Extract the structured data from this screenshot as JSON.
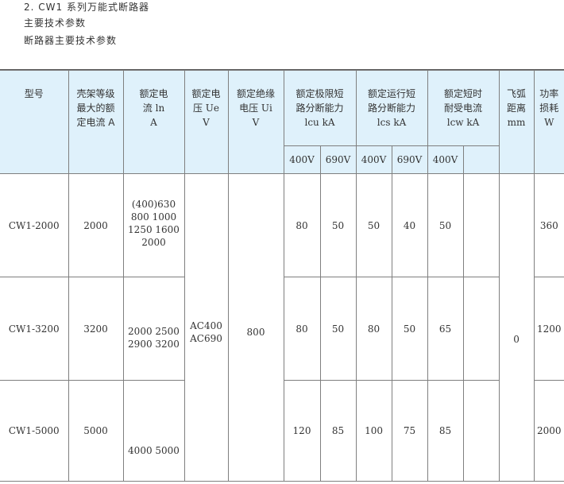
{
  "headings": {
    "line1": "2. CW1 系列万能式断路器",
    "line2": "主要技术参数",
    "line3": "断路器主要技术参数"
  },
  "table": {
    "headers": {
      "model": "型号",
      "frame_lines": [
        "壳架等级",
        "最大的额",
        "定电流 A"
      ],
      "rated_current_lines": [
        "额定电",
        "流 ln",
        "A"
      ],
      "rated_voltage_lines": [
        "额定电",
        "压 Ue",
        "V"
      ],
      "insulation_voltage_lines": [
        "额定绝缘",
        "电压 Ui",
        "V"
      ],
      "icu_lines": [
        "额定极限短",
        "路分断能力",
        "lcu  kA"
      ],
      "ics_lines": [
        "额定运行短",
        "路分断能力",
        "lcs  kA"
      ],
      "icw_lines": [
        "额定短时",
        "耐受电流",
        "lcw  kA"
      ],
      "arc_lines": [
        "飞弧",
        "距离",
        "mm"
      ],
      "power_lines": [
        "功率",
        "损耗",
        "W"
      ],
      "voltages": [
        "400V",
        "690V",
        "400V",
        "690V",
        "400V"
      ]
    },
    "rows": [
      {
        "model": "CW1-2000",
        "frame": "2000",
        "current_lines": [
          "(400)630",
          "800  1000",
          "1250  1600",
          "2000"
        ],
        "icu_400": "80",
        "icu_690": "50",
        "ics_400": "50",
        "ics_690": "40",
        "icw_400": "50",
        "power": "360"
      },
      {
        "model": "CW1-3200",
        "frame": "3200",
        "current_lines": [
          "2000  2500",
          "2900  3200"
        ],
        "voltage_lines": [
          "AC400",
          "AC690"
        ],
        "insulation": "800",
        "icu_400": "80",
        "icu_690": "50",
        "ics_400": "80",
        "ics_690": "50",
        "icw_400": "65",
        "arc": "0",
        "power": "1200"
      },
      {
        "model": "CW1-5000",
        "frame": "5000",
        "current_lines": [
          "4000  5000"
        ],
        "icu_400": "120",
        "icu_690": "85",
        "ics_400": "100",
        "ics_690": "75",
        "icw_400": "85",
        "power": "2000"
      }
    ]
  }
}
